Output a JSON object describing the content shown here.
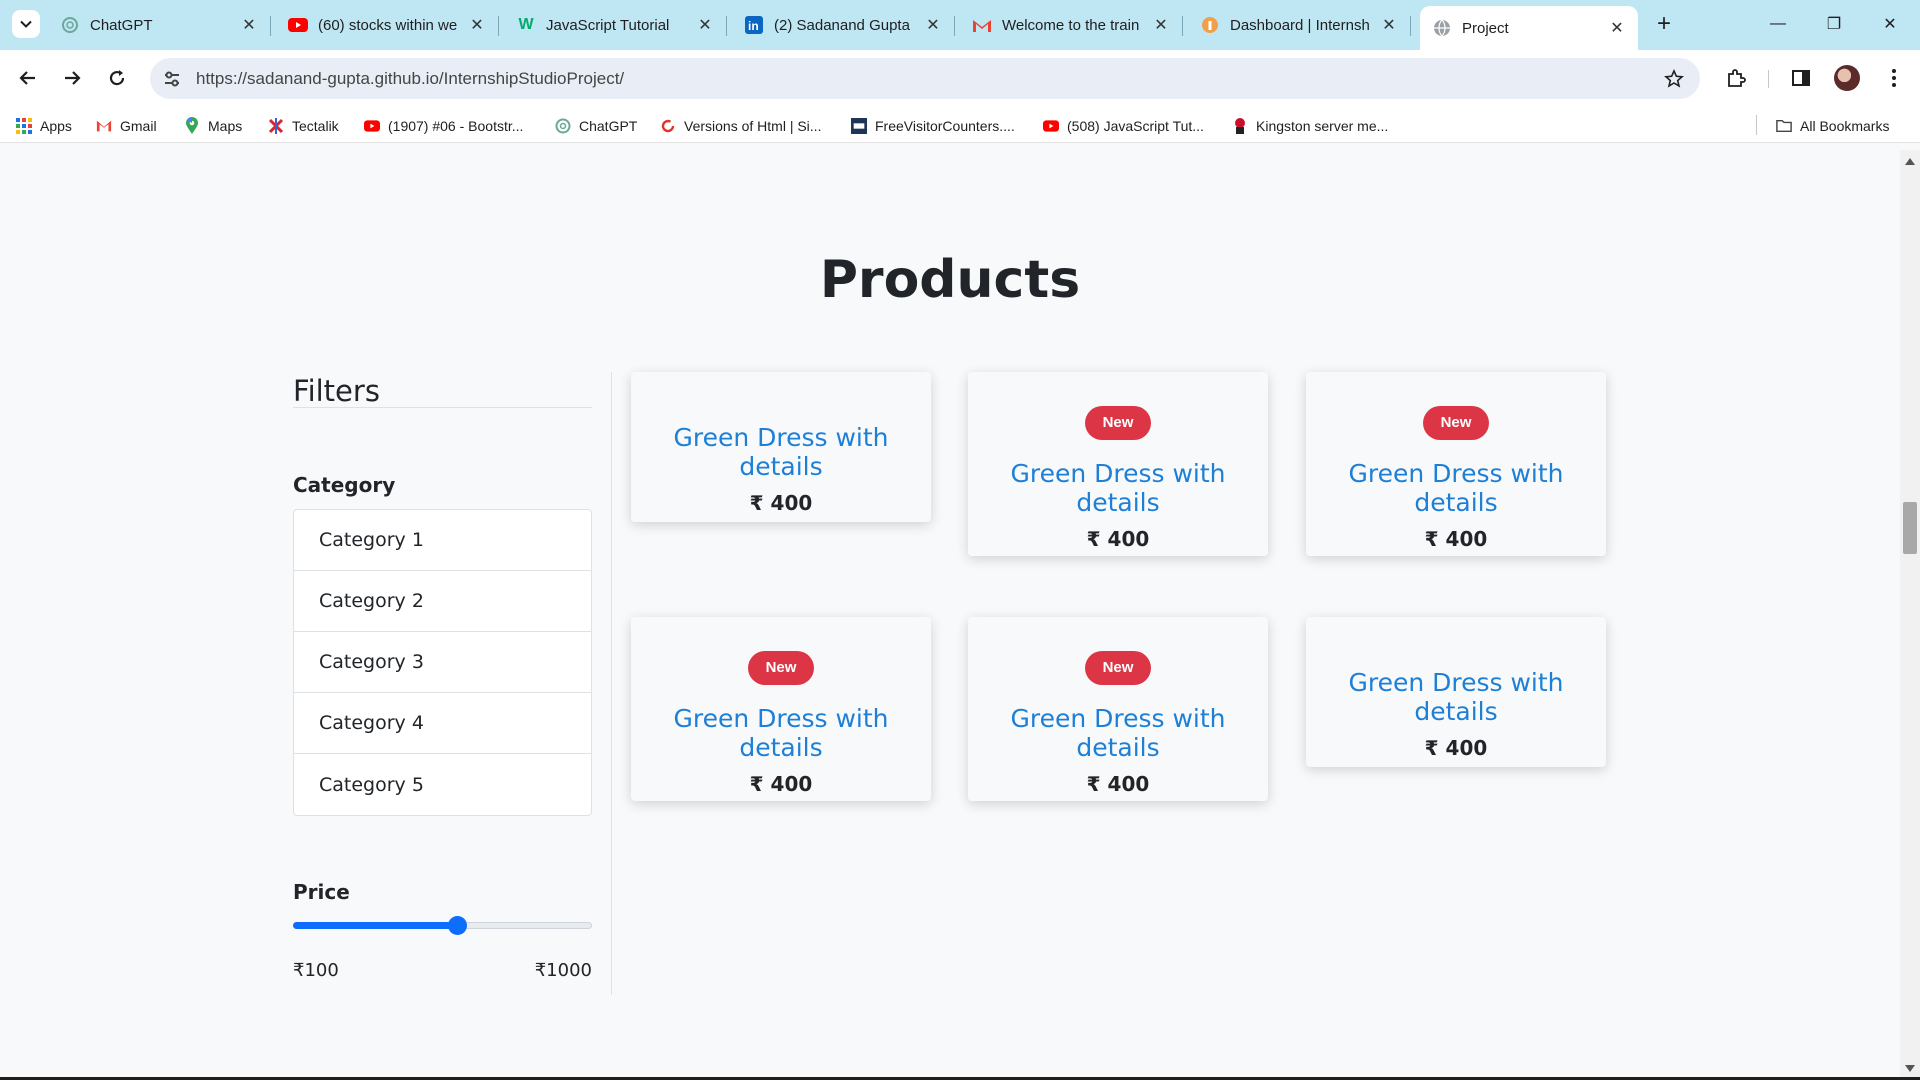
{
  "browser": {
    "tabs": [
      {
        "title": "ChatGPT",
        "icon": "chatgpt-icon"
      },
      {
        "title": "(60) stocks within we",
        "icon": "youtube-icon"
      },
      {
        "title": "JavaScript Tutorial",
        "icon": "w3schools-icon"
      },
      {
        "title": "(2) Sadanand Gupta",
        "icon": "linkedin-icon"
      },
      {
        "title": "Welcome to the train",
        "icon": "gmail-icon"
      },
      {
        "title": "Dashboard | Internsh",
        "icon": "internshala-icon"
      },
      {
        "title": "Project",
        "icon": "globe-icon"
      }
    ],
    "url_prefix": "https://",
    "url_host": "sadanand-gupta.github.io",
    "url_path": "/InternshipStudioProject/",
    "bookmarks": [
      {
        "label": "Apps",
        "icon": "apps-grid-icon"
      },
      {
        "label": "Gmail",
        "icon": "gmail-icon"
      },
      {
        "label": "Maps",
        "icon": "maps-pin-icon"
      },
      {
        "label": "Tectalik",
        "icon": "tectalik-icon"
      },
      {
        "label": "(1907) #06 - Bootstr...",
        "icon": "youtube-icon"
      },
      {
        "label": "ChatGPT",
        "icon": "chatgpt-icon"
      },
      {
        "label": "Versions of Html | Si...",
        "icon": "refresh-red-icon"
      },
      {
        "label": "FreeVisitorCounters....",
        "icon": "counter-icon"
      },
      {
        "label": "(508) JavaScript Tut...",
        "icon": "youtube-icon"
      },
      {
        "label": "Kingston server me...",
        "icon": "kingston-icon"
      }
    ],
    "all_bookmarks": "All Bookmarks"
  },
  "page": {
    "title": "Products",
    "filters": {
      "title": "Filters",
      "category_heading": "Category",
      "categories": [
        "Category 1",
        "Category 2",
        "Category 3",
        "Category 4",
        "Category 5"
      ],
      "price_heading": "Price",
      "price_min_label": "₹100",
      "price_max_label": "₹1000",
      "price_slider_fraction": 0.55
    },
    "products": [
      {
        "name": "Green Dress with details",
        "price": "₹ 400",
        "badge": ""
      },
      {
        "name": "Green Dress with details",
        "price": "₹ 400",
        "badge": "New"
      },
      {
        "name": "Green Dress with details",
        "price": "₹ 400",
        "badge": "New"
      },
      {
        "name": "Green Dress with details",
        "price": "₹ 400",
        "badge": "New"
      },
      {
        "name": "Green Dress with details",
        "price": "₹ 400",
        "badge": "New"
      },
      {
        "name": "Green Dress with details",
        "price": "₹ 400",
        "badge": ""
      }
    ]
  },
  "colors": {
    "tab_strip": "#bfe6f3",
    "badge": "#dc3545",
    "product_link": "#1e7fd6",
    "slider": "#0d6efd"
  }
}
